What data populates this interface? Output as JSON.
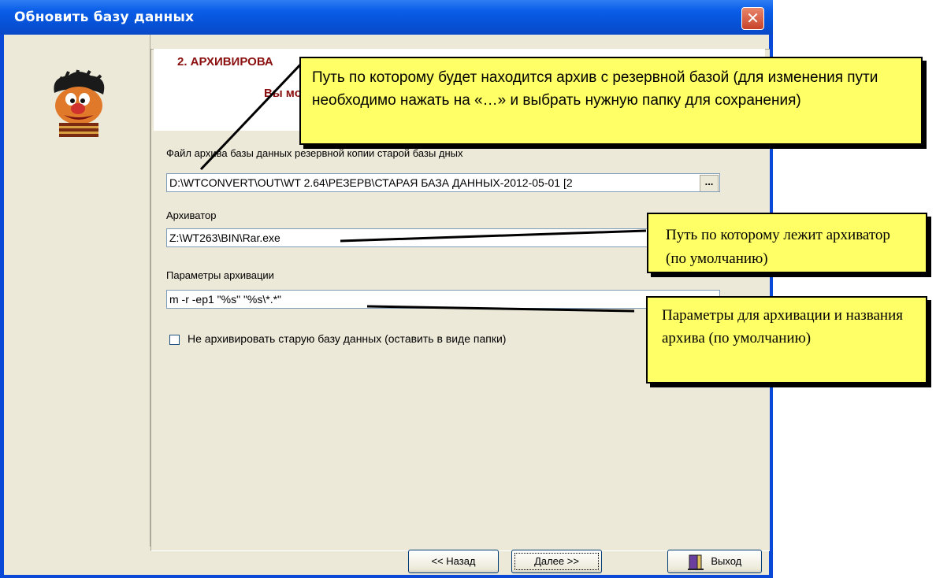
{
  "window": {
    "title": "Обновить базу данных",
    "close_symbol": "✕"
  },
  "header": {
    "step_title": "2. АРХИВИРОВА",
    "subtitle": "Вы мо"
  },
  "form": {
    "archive_file": {
      "label": "Файл архива базы данных резервной копии старой базы дных",
      "value": "D:\\WTCONVERT\\OUT\\WT 2.64\\РЕЗЕРВ\\СТАРАЯ БАЗА ДАННЫХ-2012-05-01 [2",
      "browse_label": "..."
    },
    "archiver": {
      "label": "Архиватор",
      "value": "Z:\\WT263\\BIN\\Rar.exe"
    },
    "params": {
      "label": "Параметры архивации",
      "value": "m -r -ep1 \"%s\" \"%s\\*.*\""
    },
    "no_archive": {
      "label": "Не архивировать старую базу данных (оставить в виде папки)",
      "checked": false
    }
  },
  "buttons": {
    "back": "<< Назад",
    "next": "Далее >>",
    "exit": "Выход"
  },
  "callouts": {
    "path_note": "Путь по которому будет находится архив с резервной базой (для изменения пути необходимо нажать на «…» и выбрать нужную папку для сохранения)",
    "archiver_note": "Путь по которому лежит архиватор (по умолчанию)",
    "params_note": "Параметры для архивации и названия архива (по умолчанию)"
  },
  "colors": {
    "titlebar": "#0a5ee8",
    "panel": "#ece9d8",
    "callout": "#ffff66",
    "header_text": "#8b0f0f"
  }
}
